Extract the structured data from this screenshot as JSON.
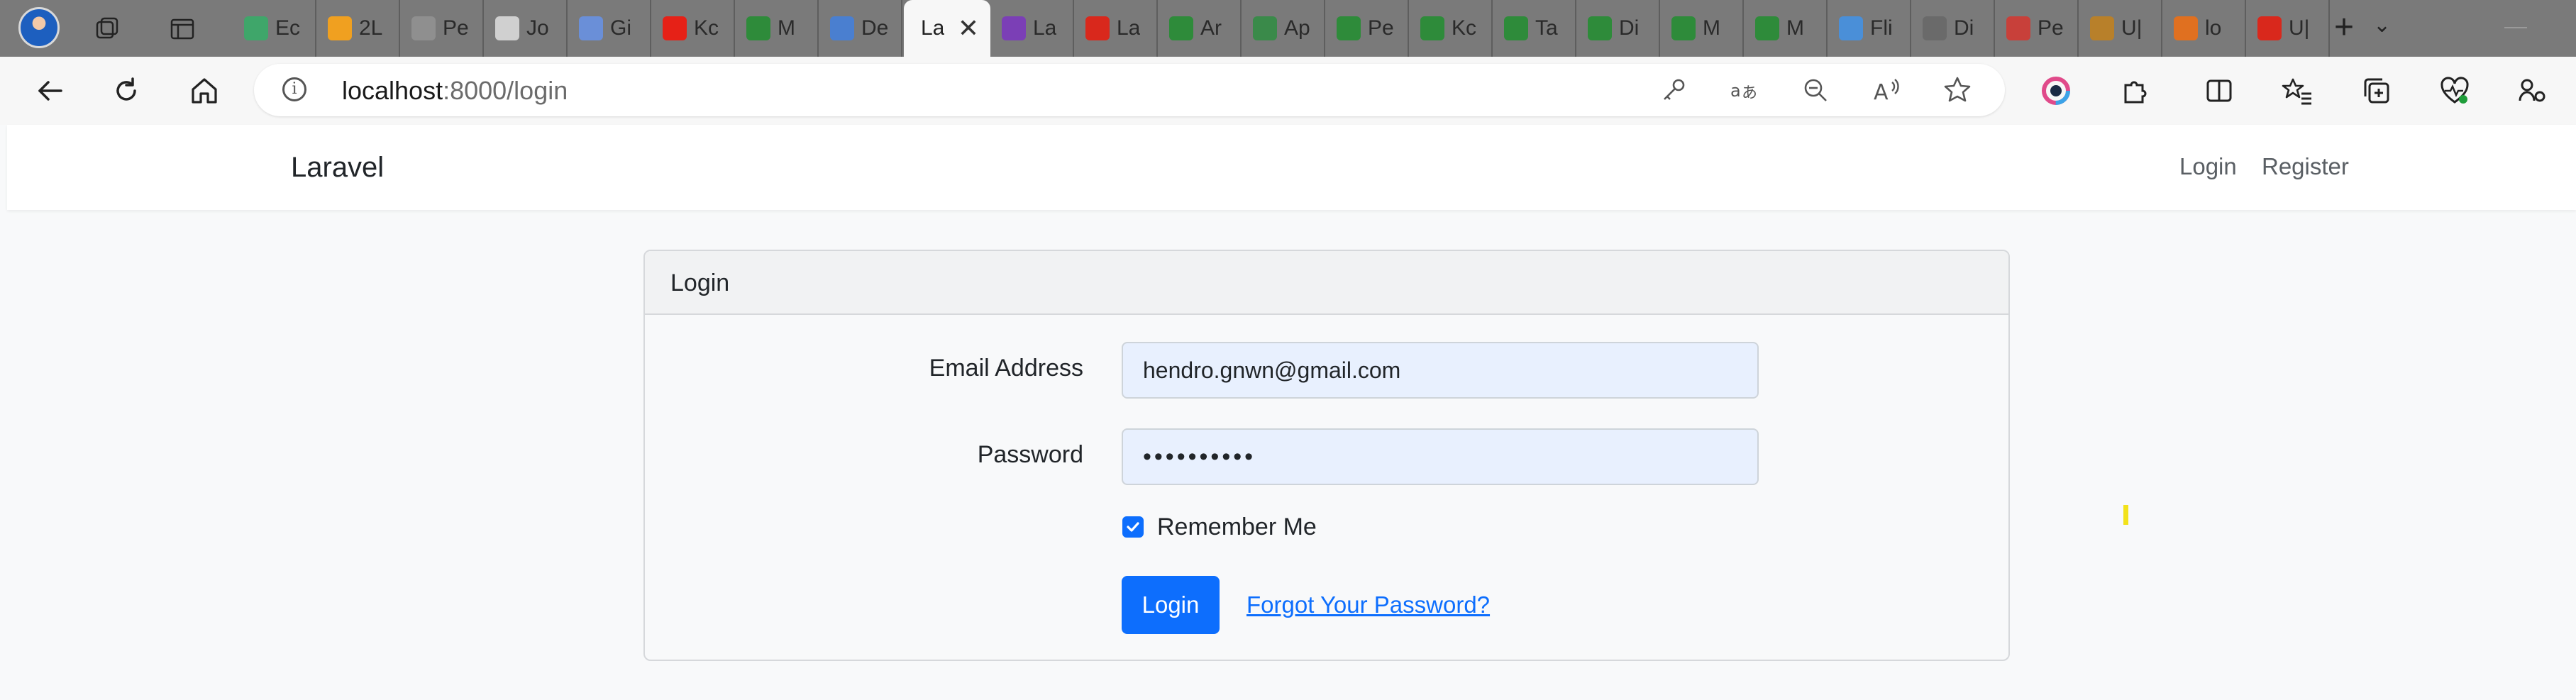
{
  "browser": {
    "tabs": [
      {
        "label": "Ec",
        "color": "#3fa66a"
      },
      {
        "label": "2L",
        "color": "#f0a020"
      },
      {
        "label": "Pe",
        "color": "#8f8f8f"
      },
      {
        "label": "Jo",
        "color": "#d0d0d0"
      },
      {
        "label": "Gi",
        "color": "#6a8fd8"
      },
      {
        "label": "Kc",
        "color": "#e62117"
      },
      {
        "label": "M",
        "color": "#2e8b3a"
      },
      {
        "label": "De",
        "color": "#4a7fd0"
      },
      {
        "label": "La",
        "color": "#e5482d",
        "active": true
      },
      {
        "label": "La",
        "color": "#7b3fb6"
      },
      {
        "label": "La",
        "color": "#d9281c"
      },
      {
        "label": "Ar",
        "color": "#2e8b3a"
      },
      {
        "label": "Ap",
        "color": "#3a8a4a"
      },
      {
        "label": "Pe",
        "color": "#2e8b3a"
      },
      {
        "label": "Kc",
        "color": "#2e8b3a"
      },
      {
        "label": "Ta",
        "color": "#2e8b3a"
      },
      {
        "label": "Di",
        "color": "#2e8b3a"
      },
      {
        "label": "M",
        "color": "#2e8b3a"
      },
      {
        "label": "M",
        "color": "#2e8b3a"
      },
      {
        "label": "Fli",
        "color": "#4a8fd8"
      },
      {
        "label": "Di",
        "color": "#6a6a6a"
      },
      {
        "label": "Pe",
        "color": "#c8403a"
      },
      {
        "label": "U|",
        "color": "#b8802a"
      },
      {
        "label": "lo",
        "color": "#e07020"
      },
      {
        "label": "U|",
        "color": "#d9281c"
      }
    ],
    "close_glyph": "✕",
    "new_tab_glyph": "+",
    "tab_menu_glyph": "⌄",
    "url_host": "localhost",
    "url_rest": ":8000/login"
  },
  "navbar": {
    "brand": "Laravel",
    "login_link": "Login",
    "register_link": "Register"
  },
  "card": {
    "title": "Login",
    "email_label": "Email Address",
    "email_value": "hendro.gnwn@gmail.com",
    "password_label": "Password",
    "password_value": "••••••••••",
    "remember_label": "Remember Me",
    "remember_checked": true,
    "login_button": "Login",
    "forgot_link": "Forgot Your Password?"
  },
  "colors": {
    "primary": "#0d6efd",
    "autofill_bg": "#e8f0fe",
    "tabstrip_bg": "#7a7a7a"
  }
}
